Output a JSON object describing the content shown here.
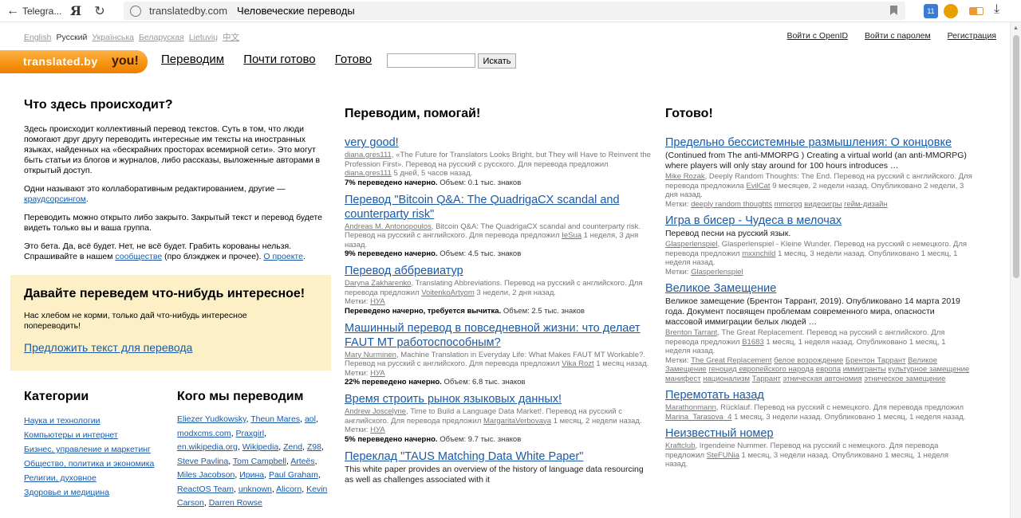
{
  "browser": {
    "back_label": "Telegra...",
    "yandex": "Я",
    "domain": "translatedby.com",
    "page_title": "Человеческие переводы",
    "calendar_badge": "11"
  },
  "langs": [
    {
      "label": "English",
      "current": false
    },
    {
      "label": "Русский",
      "current": true
    },
    {
      "label": "Українська",
      "current": false
    },
    {
      "label": "Беларуская",
      "current": false
    },
    {
      "label": "Lietuvių",
      "current": false
    },
    {
      "label": "中文",
      "current": false
    }
  ],
  "auth": {
    "openid": "Войти с OpenID",
    "password": "Войти с паролем",
    "register": "Регистрация"
  },
  "logo": {
    "part1": "translated.by",
    "part2": "you!"
  },
  "nav": [
    "Переводим",
    "Почти готово",
    "Готово"
  ],
  "search": {
    "button": "Искать",
    "placeholder": ""
  },
  "about": {
    "title": "Что здесь происходит?",
    "p1": "Здесь происходит коллективный перевод текстов. Суть в том, что люди помогают друг другу переводить интересные им тексты на иностранных языках, найденных на «бескрайних просторах всемирной сети». Это могут быть статьи из блогов и журналов, либо рассказы, выложенные авторами в открытый доступ.",
    "p2_pre": "Одни называют это коллаборативным редактированием, другие —",
    "p2_link": "краудсорсингом",
    "p2_post": ".",
    "p3": "Переводить можно открыто либо закрыто. Закрытый текст и перевод будете видеть только вы и ваша группа.",
    "p4_pre": "Это бета. Да, всё будет. Нет, не всё будет. Грабить корованы нельзя. Спрашивайте в нашем",
    "p4_link1": "сообществе",
    "p4_mid": "(про блэкджек и прочее).",
    "p4_link2": "О проекте",
    "p4_post": "."
  },
  "promo": {
    "title": "Давайте переведем что-нибудь интересное!",
    "text": "Нас хлебом не корми, только дай что-нибудь интересное попереводить!",
    "link": "Предложить текст для перевода"
  },
  "categories": {
    "title": "Категории",
    "items": [
      "Наука и технологии",
      "Компьютеры и интернет",
      "Бизнес, управление и маркетинг",
      "Общество, политика и экономика",
      "Религии, духовное",
      "Здоровье и медицина"
    ]
  },
  "who": {
    "title": "Кого мы переводим",
    "items": [
      "Eliezer Yudkowsky",
      "Theun Mares",
      "aol",
      "modxcms.com",
      "Praxgirl",
      "en.wikipedia.org",
      "Wikipedia",
      "Zend",
      "Z98",
      "Steve Pavlina",
      "Tom Campbell",
      "Arteës",
      "Miles Jacobson",
      "Ирина",
      "Paul Graham",
      "ReactOS Team",
      "unknown",
      "Alicorn",
      "Kevin Carson",
      "Darren Rowse"
    ]
  },
  "translating": {
    "title": "Переводим, помогай!",
    "entries": [
      {
        "title": "very good!",
        "author": "diana.gres111",
        "meta": ", «The Future for Translators Looks Bright, but They will Have to Reinvent the Profession First». Перевод на русский с русского. Для перевода предложил",
        "proposer": "diana.gres111",
        "time": "5 дней, 5 часов назад.",
        "tags": "",
        "status": "7% переведено начерно.",
        "volume": "Объем: 0.1 тыс. знаков"
      },
      {
        "title": "Перевод \"Bitcoin Q&A: The QuadrigaCX scandal and counterparty risk\"",
        "author": "Andreas M. Antonopoulos",
        "meta": ", Bitcoin Q&A: The QuadrigaCX scandal and counterparty risk. Перевод на русский с английского. Для перевода предложил",
        "proposer": "IeSua",
        "time": "1 неделя, 3 дня назад.",
        "tags": "",
        "status": "9% переведено начерно.",
        "volume": "Объем: 4.5 тыс. знаков"
      },
      {
        "title": "Перевод аббревиатур",
        "author": "Daryna Zakharenko",
        "meta": ", Translating Abbreviations. Перевод на русский с английского. Для перевода предложил",
        "proposer": "VoitenkoArtyom",
        "time": "3 недели, 2 дня назад.",
        "tags": "НУА",
        "status": "Переведено начерно, требуется вычитка.",
        "volume": "Объем: 2.5 тыс. знаков"
      },
      {
        "title": "Машинный перевод в повседневной жизни: что делает FAUT MT работоспособным?",
        "author": "Mary Nurminen",
        "meta": ", Machine Translation in Everyday Life: What Makes FAUT MT Workable?. Перевод на русский с английского. Для перевода предложил",
        "proposer": "Vika Rozt",
        "time": "1 месяц назад.",
        "tags": "НУА",
        "status": "22% переведено начерно.",
        "volume": "Объем: 6.8 тыс. знаков"
      },
      {
        "title": "Время строить рынок языковых данных!",
        "author": "Andrew Joscelyne",
        "meta": ", Time to Build a Language Data Market!. Перевод на русский с английского. Для перевода предложил",
        "proposer": "MargaritaVerbovaya",
        "time": "1 месяц, 2 недели назад.",
        "tags": "НУА",
        "status": "5% переведено начерно.",
        "volume": "Объем: 9.7 тыс. знаков"
      },
      {
        "title": "Переклад \"TAUS Matching Data White Paper\"",
        "author": "",
        "meta": "",
        "proposer": "",
        "time": "",
        "tags": "",
        "desc": "This white paper provides an overview of the history of language data resourcing as well as challenges associated with it",
        "status": "",
        "volume": ""
      }
    ]
  },
  "done": {
    "title": "Готово!",
    "entries": [
      {
        "title": "Предельно бессистемные размышления: О концовке",
        "desc": "(Continued from The anti-MMORPG ) Creating a virtual world (an anti-MMORPG) where players will only stay around for 100 hours introduces …",
        "author": "Mike Rozak",
        "meta": ", Deeply Random Thoughts: The End. Перевод на русский с английского. Для перевода предложила",
        "proposer": "EvilCat",
        "time": "9 месяцев, 2 недели назад. Опубликовано 2 недели, 3 дня назад.",
        "tags": [
          "deeply random thoughts",
          "mmorpg",
          "видеоигры",
          "гейм-дизайн"
        ]
      },
      {
        "title": "Игра в бисер - Чудеса в мелочах",
        "desc": "Перевод песни на русский язык.",
        "author": "Glasperlenspiel",
        "meta": ", Glasperlenspiel - Kleine Wunder. Перевод на русский с немецкого. Для перевода предложил",
        "proposer": "mxxnchild",
        "time": "1 месяц, 3 недели назад. Опубликовано 1 месяц, 1 неделя назад.",
        "tags": [
          "Glasperlenspiel"
        ]
      },
      {
        "title": "Великое Замещение",
        "desc": "Великое замещение (Брентон Таррант, 2019). Опубликовано 14 марта 2019 года. Документ посвящен проблемам современного мира, опасности массовой иммиграции белых людей …",
        "author": "Brenton Tarrant",
        "meta": ", The Great Replacement. Перевод на русский с английского. Для перевода предложил",
        "proposer": "B1683",
        "time": "1 месяц, 1 неделя назад. Опубликовано 1 месяц, 1 неделя назад.",
        "tags": [
          "The Great Replacement",
          "белое возрождение",
          "Брентон Таррант",
          "Великое Замещение",
          "геноцид европейского народа",
          "европа",
          "иммигранты",
          "культурное замещение",
          "манифест",
          "национализм",
          "Таррант",
          "этническая автономия",
          "этническое замещение"
        ]
      },
      {
        "title": "Перемотать назад",
        "desc": "",
        "author": "Marathonmann",
        "meta": ", Rücklauf. Перевод на русский с немецкого. Для перевода предложил",
        "proposer": "Marina_Tarasova_4",
        "time": "1 месяц, 3 недели назад. Опубликовано 1 месяц, 1 неделя назад.",
        "tags": []
      },
      {
        "title": "Неизвестный номер",
        "desc": "",
        "author": "Kraftclub",
        "meta": ", Irgendeine Nummer. Перевод на русский с немецкого. Для перевода предложил",
        "proposer": "SteFUNia",
        "time": "1 месяц, 3 недели назад. Опубликовано 1 месяц, 1 неделя назад.",
        "tags": []
      }
    ]
  },
  "labels": {
    "tags": "Метки:"
  }
}
